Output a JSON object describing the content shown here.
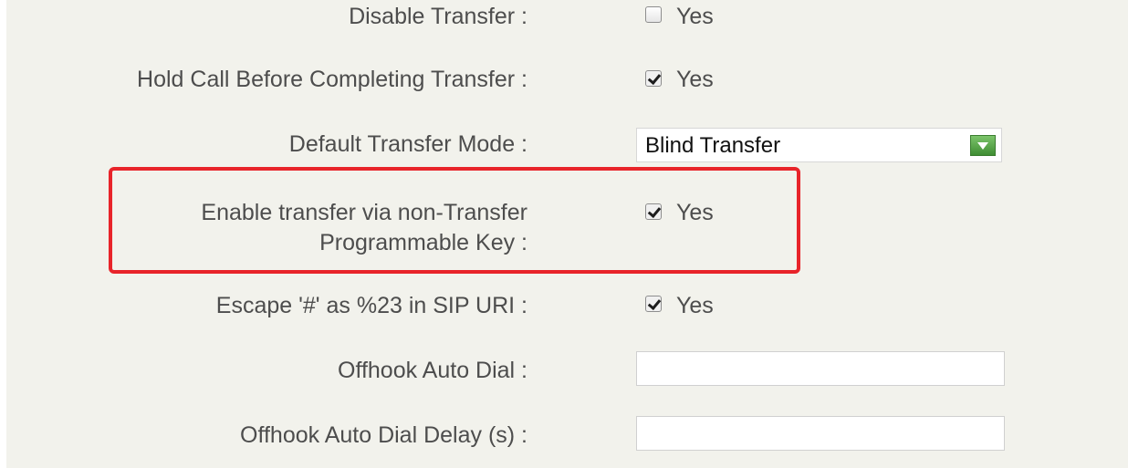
{
  "settings": {
    "disable_transfer": {
      "label": "Disable Transfer :",
      "checked": false,
      "option": "Yes"
    },
    "hold_call": {
      "label": "Hold Call Before Completing Transfer :",
      "checked": true,
      "option": "Yes"
    },
    "default_transfer_mode": {
      "label": "Default Transfer Mode :",
      "value": "Blind Transfer"
    },
    "enable_transfer_nontransfer_key": {
      "label_line1": "Enable transfer via non-Transfer",
      "label_line2": "Programmable Key :",
      "checked": true,
      "option": "Yes"
    },
    "escape_hash": {
      "label": "Escape '#' as %23 in SIP URI :",
      "checked": true,
      "option": "Yes"
    },
    "offhook_auto_dial": {
      "label": "Offhook Auto Dial :",
      "value": ""
    },
    "offhook_auto_dial_delay": {
      "label": "Offhook Auto Dial Delay (s) :",
      "value": ""
    }
  },
  "colors": {
    "highlight": "#e8242a",
    "panel_bg": "#f2f2ec",
    "dropdown_button": "#4fa23f"
  }
}
